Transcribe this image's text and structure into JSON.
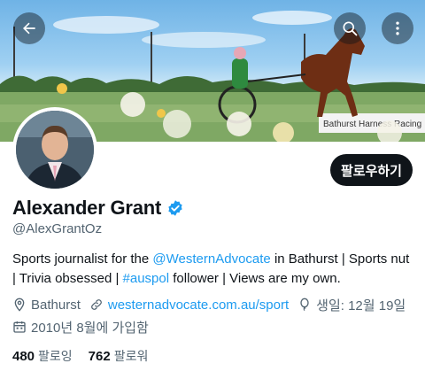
{
  "profile": {
    "display_name": "Alexander Grant",
    "handle": "@AlexGrantOz",
    "follow_label": "팔로우하기",
    "bio": {
      "p1": "Sports journalist for the ",
      "mention": "@WesternAdvocate",
      "p2": " in Bathurst | Sports nut | Trivia obsessed | ",
      "hashtag": "#auspol",
      "p3": " follower | Views are my own."
    },
    "location": "Bathurst",
    "website": "westernadvocate.com.au/sport",
    "birthday": "생일: 12월 19일",
    "joined": "2010년 8월에 가입함",
    "following_count": "480",
    "following_label": "팔로잉",
    "followers_count": "762",
    "followers_label": "팔로워"
  },
  "banner": {
    "sign_text": "Bathurst Harness Racing"
  },
  "icons": {
    "back": "arrow-left-icon",
    "search": "search-icon",
    "more": "more-vertical-icon",
    "verified": "verified-badge-icon",
    "location": "location-pin-icon",
    "website": "link-icon",
    "birthday": "balloon-icon",
    "joined": "calendar-icon"
  },
  "colors": {
    "accent": "#1d9bf0",
    "text": "#0f1419",
    "muted": "#536471",
    "button": "#0f1419"
  }
}
